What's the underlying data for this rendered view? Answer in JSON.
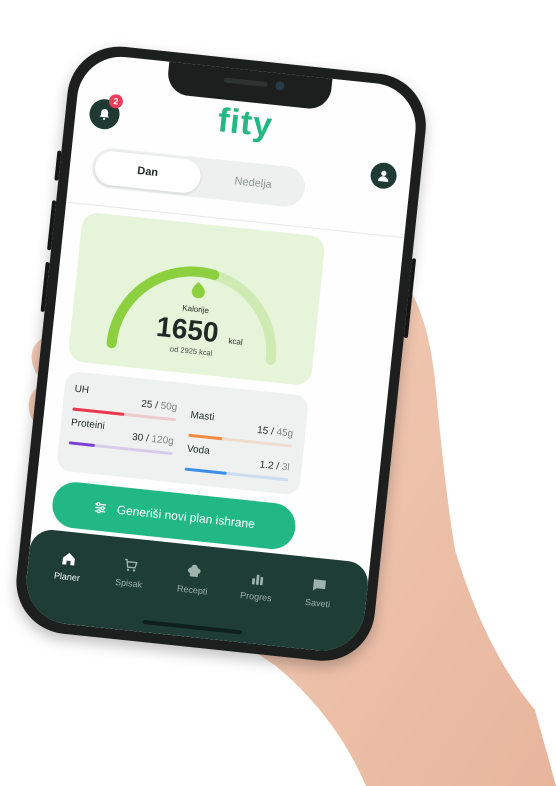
{
  "app": {
    "logo": "fity",
    "notifications_count": "2"
  },
  "segmented": {
    "day": "Dan",
    "week": "Nedelja",
    "active": "Dan"
  },
  "calories": {
    "label": "Kalorije",
    "value": "1650",
    "unit": "kcal",
    "goal_text": "od 2925 kcal",
    "progress": 0.56
  },
  "macros": [
    {
      "name": "UH",
      "current": "25",
      "goal": "50g",
      "progress": 0.5,
      "color": "#e8394f"
    },
    {
      "name": "Masti",
      "current": "15",
      "goal": "45g",
      "progress": 0.33,
      "color": "#f28b40"
    },
    {
      "name": "Proteini",
      "current": "30",
      "goal": "120g",
      "progress": 0.25,
      "color": "#7a3fd6"
    },
    {
      "name": "Voda",
      "current": "1.2",
      "goal": "3l",
      "progress": 0.4,
      "color": "#3b8fe8"
    }
  ],
  "cta": {
    "label": "Generiši novi plan ishrane"
  },
  "nav": [
    {
      "label": "Planer",
      "icon": "home-icon",
      "active": true
    },
    {
      "label": "Spisak",
      "icon": "cart-icon",
      "active": false
    },
    {
      "label": "Recepti",
      "icon": "chef-hat-icon",
      "active": false
    },
    {
      "label": "Progres",
      "icon": "bar-chart-icon",
      "active": false
    },
    {
      "label": "Saveti",
      "icon": "chat-icon",
      "active": false
    }
  ],
  "colors": {
    "brand": "#23b882",
    "dark": "#1d3d35",
    "gauge_fill": "#8ccf3f",
    "gauge_track": "#cfeab3",
    "badge": "#ef3b5a"
  }
}
